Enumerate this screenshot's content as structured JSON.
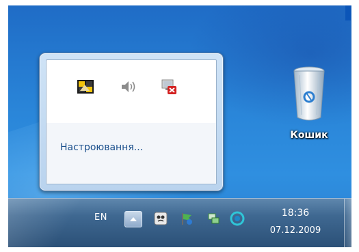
{
  "popup": {
    "icons": [
      "tray-app-icon",
      "speaker-icon",
      "network-disconnected-icon"
    ],
    "customize_link": "Настроювання..."
  },
  "desktop": {
    "recycle_bin_label": "Кошик"
  },
  "taskbar": {
    "language": "EN",
    "tray_icons": [
      "show-hidden-icons-button",
      "antivirus-icon",
      "flag-icon",
      "network-icon",
      "sync-icon"
    ],
    "time": "18:36",
    "date": "07.12.2009"
  }
}
